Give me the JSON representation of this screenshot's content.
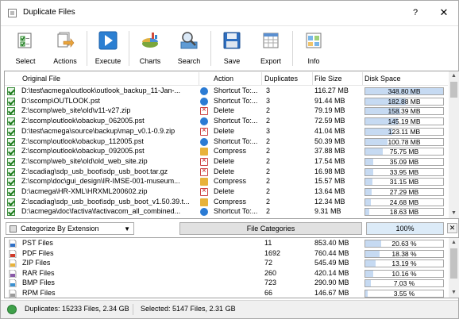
{
  "window": {
    "title": "Duplicate Files",
    "help": "?",
    "close": "✕"
  },
  "toolbar": [
    {
      "label": "Select",
      "icon": "select-icon"
    },
    {
      "label": "Actions",
      "icon": "actions-icon"
    },
    {
      "label": "Execute",
      "icon": "execute-icon"
    },
    {
      "label": "Charts",
      "icon": "charts-icon"
    },
    {
      "label": "Search",
      "icon": "search-icon"
    },
    {
      "label": "Save",
      "icon": "save-icon"
    },
    {
      "label": "Export",
      "icon": "export-icon"
    },
    {
      "label": "Info",
      "icon": "info-icon"
    }
  ],
  "grid": {
    "columns": [
      "Original File",
      "Action",
      "Duplicates",
      "File Size",
      "Disk Space"
    ],
    "rows": [
      {
        "file": "D:\\test\\acmega\\outlook\\outlook_backup_11-Jan-...",
        "action": "Shortcut To:...",
        "action_type": "shortcut",
        "dups": "3",
        "size": "116.27 MB",
        "disk": "348.80 MB",
        "pct": 1.0
      },
      {
        "file": "D:\\scomp\\OUTLOOK.pst",
        "action": "Shortcut To:...",
        "action_type": "shortcut",
        "dups": "3",
        "size": "91.44 MB",
        "disk": "182.88 MB",
        "pct": 0.52
      },
      {
        "file": "Z:\\scomp\\web_site\\old\\v11-v27.zip",
        "action": "Delete",
        "action_type": "delete",
        "dups": "2",
        "size": "79.19 MB",
        "disk": "158.39 MB",
        "pct": 0.45
      },
      {
        "file": "Z:\\scomp\\outlook\\obackup_062005.pst",
        "action": "Shortcut To:...",
        "action_type": "shortcut",
        "dups": "2",
        "size": "72.59 MB",
        "disk": "145.19 MB",
        "pct": 0.42
      },
      {
        "file": "D:\\test\\acmega\\source\\backup\\map_v0.1-0.9.zip",
        "action": "Delete",
        "action_type": "delete",
        "dups": "3",
        "size": "41.04 MB",
        "disk": "123.11 MB",
        "pct": 0.35
      },
      {
        "file": "Z:\\scomp\\outlook\\obackup_112005.pst",
        "action": "Shortcut To:...",
        "action_type": "shortcut",
        "dups": "2",
        "size": "50.39 MB",
        "disk": "100.78 MB",
        "pct": 0.29
      },
      {
        "file": "Z:\\scomp\\outlook\\obackup_092005.pst",
        "action": "Compress",
        "action_type": "compress",
        "dups": "2",
        "size": "37.88 MB",
        "disk": "75.75 MB",
        "pct": 0.22
      },
      {
        "file": "Z:\\scomp\\web_site\\old\\old_web_site.zip",
        "action": "Delete",
        "action_type": "delete",
        "dups": "2",
        "size": "17.54 MB",
        "disk": "35.09 MB",
        "pct": 0.1
      },
      {
        "file": "Z:\\scadiag\\sdp_usb_boot\\sdp_usb_boot.tar.gz",
        "action": "Delete",
        "action_type": "delete",
        "dups": "2",
        "size": "16.98 MB",
        "disk": "33.95 MB",
        "pct": 0.1
      },
      {
        "file": "Z:\\scomp\\doc\\gui_design\\IR-IMSE-001-museum...",
        "action": "Compress",
        "action_type": "compress",
        "dups": "2",
        "size": "15.57 MB",
        "disk": "31.15 MB",
        "pct": 0.09
      },
      {
        "file": "D:\\acmega\\HR-XML\\HRXML200602.zip",
        "action": "Delete",
        "action_type": "delete",
        "dups": "2",
        "size": "13.64 MB",
        "disk": "27.29 MB",
        "pct": 0.08
      },
      {
        "file": "Z:\\scadiag\\sdp_usb_boot\\sdp_usb_boot_v1.50.39.t...",
        "action": "Compress",
        "action_type": "compress",
        "dups": "2",
        "size": "12.34 MB",
        "disk": "24.68 MB",
        "pct": 0.07
      },
      {
        "file": "D:\\acmega\\doc\\factiva\\factivacom_all_combined...",
        "action": "Shortcut To:...",
        "action_type": "shortcut",
        "dups": "2",
        "size": "9.31 MB",
        "disk": "18.63 MB",
        "pct": 0.05
      }
    ]
  },
  "midbar": {
    "categorize": "Categorize By Extension",
    "file_categories": "File Categories",
    "percent": "100%",
    "close": "✕"
  },
  "categories": [
    {
      "name": "PST Files",
      "count": "11",
      "size": "853.40 MB",
      "pct_label": "20.63 %",
      "pct": 0.2063,
      "icon": "pst-file-icon",
      "color": "#2f6fc6"
    },
    {
      "name": "PDF Files",
      "count": "1692",
      "size": "760.44 MB",
      "pct_label": "18.38 %",
      "pct": 0.1838,
      "icon": "pdf-file-icon",
      "color": "#d03a2a"
    },
    {
      "name": "ZIP Files",
      "count": "72",
      "size": "545.49 MB",
      "pct_label": "13.19 %",
      "pct": 0.1319,
      "icon": "zip-file-icon",
      "color": "#e8b23a"
    },
    {
      "name": "RAR Files",
      "count": "260",
      "size": "420.14 MB",
      "pct_label": "10.16 %",
      "pct": 0.1016,
      "icon": "rar-file-icon",
      "color": "#8a5aa8"
    },
    {
      "name": "BMP Files",
      "count": "723",
      "size": "290.90 MB",
      "pct_label": "7.03 %",
      "pct": 0.0703,
      "icon": "bmp-file-icon",
      "color": "#3a8fd0"
    },
    {
      "name": "RPM Files",
      "count": "66",
      "size": "146.67 MB",
      "pct_label": "3.55 %",
      "pct": 0.0355,
      "icon": "rpm-file-icon",
      "color": "#9a9a9a"
    }
  ],
  "status": {
    "duplicates": "Duplicates: 15233 Files, 2.34 GB",
    "selected": "Selected: 5147 Files, 2.31 GB"
  }
}
